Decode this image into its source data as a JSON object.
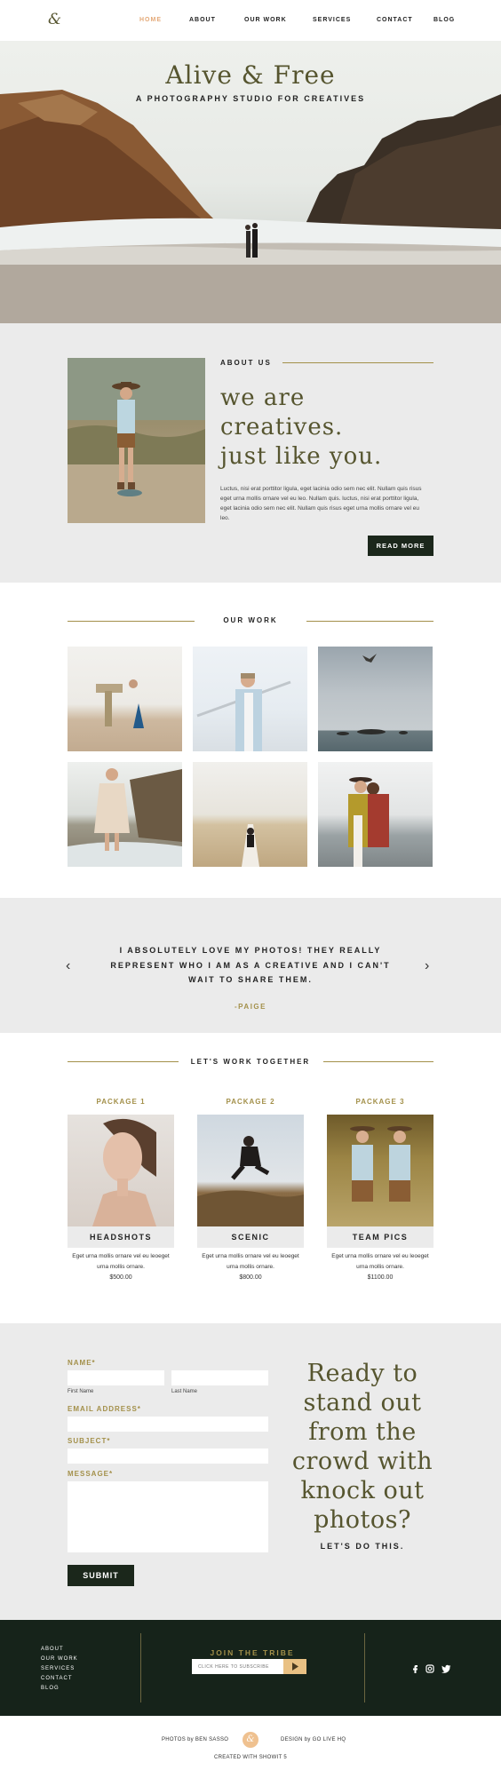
{
  "nav": {
    "logo": "&",
    "links": [
      "HOME",
      "ABOUT",
      "OUR WORK",
      "SERVICES",
      "CONTACT",
      "BLOG"
    ],
    "active_color": "#e4a978"
  },
  "hero": {
    "title": "Alive & Free",
    "subtitle": "A PHOTOGRAPHY STUDIO FOR CREATIVES"
  },
  "about": {
    "eyebrow": "ABOUT US",
    "heading": [
      "we are",
      "creatives.",
      "just like you."
    ],
    "body": "Luctus, nisi erat porttitor ligula, eget lacinia odio sem nec elit. Nullam quis risus eget urna mollis ornare vel eu leo. Nullam quis. luctus, nisi erat porttitor ligula, eget lacinia odio sem nec elit. Nullam quis risus eget urna mollis ornare vel eu leo.",
    "button": "READ MORE"
  },
  "work": {
    "title": "OUR WORK"
  },
  "testimonial": {
    "quote": "I ABSOLUTELY LOVE MY PHOTOS! THEY REALLY REPRESENT WHO I AM AS A CREATIVE AND I CAN'T WAIT TO SHARE THEM.",
    "author": "-PAIGE",
    "prev_icon": "chevron-left-icon",
    "next_icon": "chevron-right-icon"
  },
  "packages": {
    "title": "LET'S WORK TOGETHER",
    "items": [
      {
        "label": "PACKAGE 1",
        "name": "HEADSHOTS",
        "desc": "Eget urna mollis ornare vel eu leoeget urna mollis ornare.",
        "price": "$500.00"
      },
      {
        "label": "PACKAGE 2",
        "name": "SCENIC",
        "desc": "Eget urna mollis ornare vel eu leoeget urna mollis ornare.",
        "price": "$800.00"
      },
      {
        "label": "PACKAGE 3",
        "name": "TEAM PICS",
        "desc": "Eget urna mollis ornare vel eu leoeget urna mollis ornare.",
        "price": "$1100.00"
      }
    ]
  },
  "contact": {
    "name_label": "NAME*",
    "first_name": "First Name",
    "last_name": "Last Name",
    "email_label": "EMAIL ADDRESS*",
    "subject_label": "SUBJECT*",
    "message_label": "MESSAGE*",
    "submit": "SUBMIT",
    "cta": [
      "Ready to",
      "stand out",
      "from the",
      "crowd with",
      "knock out",
      "photos?"
    ],
    "cta_sub": "LET'S DO THIS."
  },
  "footer": {
    "links": [
      "ABOUT",
      "OUR WORK",
      "SERVICES",
      "CONTACT",
      "BLOG"
    ],
    "join": "JOIN THE TRIBE",
    "subscribe_placeholder": "CLICK HERE TO SUBSCRIBE",
    "social": [
      "facebook-icon",
      "instagram-icon",
      "twitter-icon"
    ]
  },
  "credits": {
    "photos": "PHOTOS by BEN SASSO",
    "design": "DESIGN by GO LIVE HQ",
    "created": "CREATED WITH SHOWIT 5",
    "badge": "&"
  }
}
